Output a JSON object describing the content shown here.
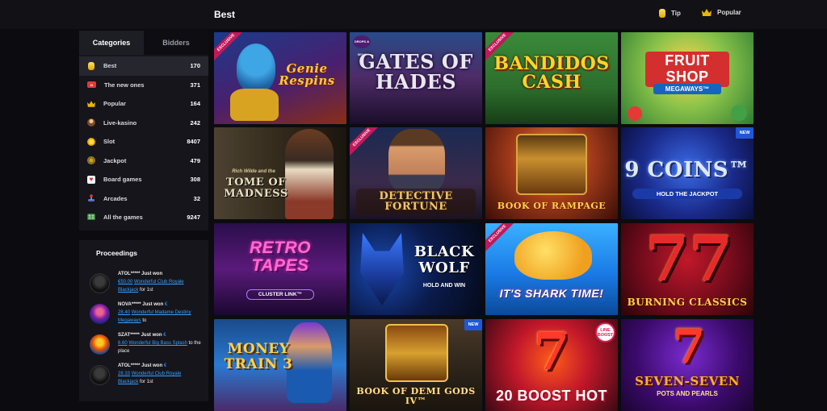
{
  "header": {
    "title": "Best",
    "filters": [
      {
        "label": "Tip",
        "icon": "coin-icon"
      },
      {
        "label": "Popular",
        "icon": "crown-icon"
      }
    ]
  },
  "sidebar": {
    "tabs": [
      {
        "label": "Categories",
        "active": true
      },
      {
        "label": "Bidders",
        "active": false
      }
    ],
    "categories": [
      {
        "label": "Best",
        "count": "170",
        "icon": "coin-icon",
        "active": true
      },
      {
        "label": "The new ones",
        "count": "371",
        "icon": "new-icon"
      },
      {
        "label": "Popular",
        "count": "164",
        "icon": "crown-icon"
      },
      {
        "label": "Live-kasino",
        "count": "242",
        "icon": "dealer-icon"
      },
      {
        "label": "Slot",
        "count": "8407",
        "icon": "coins-stack-icon"
      },
      {
        "label": "Jackpot",
        "count": "479",
        "icon": "jackpot-icon"
      },
      {
        "label": "Board games",
        "count": "308",
        "icon": "cards-icon"
      },
      {
        "label": "Arcades",
        "count": "32",
        "icon": "joystick-icon"
      },
      {
        "label": "All the games",
        "count": "9247",
        "icon": "grid-icon"
      }
    ]
  },
  "proceedings": {
    "title": "Proceedings",
    "items": [
      {
        "user": "ATOL*****",
        "action": "Just won",
        "euro": "",
        "amount": "€50.00",
        "game": "Wonderful Club Royale Blackjack",
        "suffix": "for 1st"
      },
      {
        "user": "NOVA*****",
        "action": "Just won",
        "euro": "€",
        "amount": "28.40",
        "game": "Wonderful Madame Destiny Megaways",
        "suffix": "to"
      },
      {
        "user": "SZAT*****",
        "action": "Just won",
        "euro": "€",
        "amount": "6.60",
        "game": "Wonderful Big Bass Splash",
        "suffix": "to the place"
      },
      {
        "user": "ATOL*****",
        "action": "Just won",
        "euro": "€",
        "amount": "28.33",
        "game": "Wonderful Club Royale Blackjack",
        "suffix": "for 1st"
      }
    ]
  },
  "games": [
    {
      "title": "Genie Respins",
      "badge": "EXCLUSIVE"
    },
    {
      "title": "GATES OF HADES",
      "badge": "DROPS & WINS"
    },
    {
      "title": "BANDIDOS CASH",
      "badge": "EXCLUSIVE"
    },
    {
      "title": "FRUIT SHOP",
      "subtitle": "MEGAWAYS™"
    },
    {
      "title": "TOME OF MADNESS",
      "subtitle": "Rich Wilde and the"
    },
    {
      "title": "DETECTIVE FORTUNE",
      "badge": "EXCLUSIVE"
    },
    {
      "title": "BOOK OF RAMPAGE"
    },
    {
      "title": "9 COINS™",
      "subtitle": "HOLD THE JACKPOT",
      "badge": "NEW"
    },
    {
      "title": "RETRO TAPES",
      "subtitle": "CLUSTER LINK™"
    },
    {
      "title": "BLACK WOLF",
      "subtitle": "HOLD AND WIN"
    },
    {
      "title": "IT'S SHARK TIME!",
      "badge": "EXCLUSIVE"
    },
    {
      "title": "BURNING CLASSICS"
    },
    {
      "title": "MONEY TRAIN 3"
    },
    {
      "title": "BOOK OF DEMI GODS IV™",
      "badge": "NEW"
    },
    {
      "title": "20 BOOST HOT",
      "badge": "LINE BOOST"
    },
    {
      "title": "SEVEN-SEVEN",
      "subtitle": "POTS AND PEARLS"
    }
  ]
}
